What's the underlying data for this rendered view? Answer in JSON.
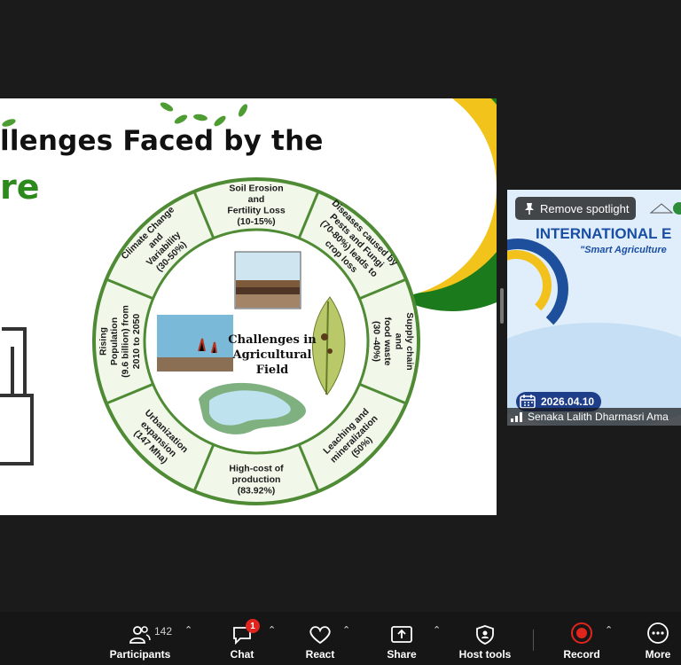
{
  "slide": {
    "title_line1": "llenges Faced by the",
    "title_line2": "re",
    "wheel": {
      "center": [
        "Challenges in",
        "Agricultural",
        "Field"
      ],
      "segments": [
        {
          "lines": [
            "Soil Erosion",
            "and",
            "Fertility Loss",
            "(10-15%)"
          ]
        },
        {
          "lines": [
            "Diseases caused by",
            "Pests and Fungi",
            "(70-80%) leads to",
            "crop loss"
          ]
        },
        {
          "lines": [
            "Supply chain",
            "and",
            "food waste",
            "(30 -40%)"
          ]
        },
        {
          "lines": [
            "Leaching and",
            "mineralization",
            "(50%)"
          ]
        },
        {
          "lines": [
            "High-cost of",
            "production",
            "(83.92%)"
          ]
        },
        {
          "lines": [
            "Urbanization",
            "expansion",
            "(147 Mha)"
          ]
        },
        {
          "lines": [
            "Rising",
            "Population",
            "(9.6 billion) from",
            "2010 to 2050"
          ]
        },
        {
          "lines": [
            "Climate Change",
            "and",
            "Variability",
            "(30-50%)"
          ]
        }
      ]
    }
  },
  "tile": {
    "title": "INTERNATIONAL E",
    "subtitle": "\"Smart Agriculture",
    "remove_spotlight": "Remove spotlight",
    "date": "2026.04.10",
    "participant_name": "Senaka Lalith Dharmasri Ama"
  },
  "toolbar": {
    "participants_label": "Participants",
    "participants_count": "142",
    "chat_label": "Chat",
    "chat_badge": "1",
    "react_label": "React",
    "share_label": "Share",
    "host_tools_label": "Host tools",
    "record_label": "Record",
    "more_label": "More"
  },
  "colors": {
    "slide_green": "#2c8a1c",
    "wheel_border": "#5a8a3a",
    "record_red": "#e0251f",
    "toolbar_bg": "#161616"
  }
}
